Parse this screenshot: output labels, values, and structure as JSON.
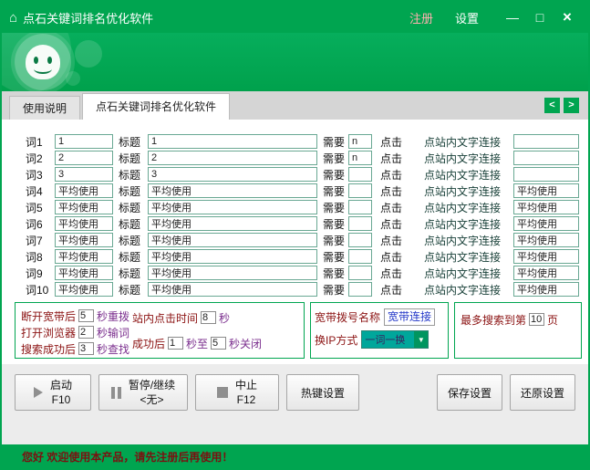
{
  "colors": {
    "brand_green": "#00A550",
    "teal_field": "#00A79B",
    "yellow_field": "#FFFF00",
    "olive_field": "#AEA400",
    "label_maroon": "#8B1212",
    "suffix_purple": "#7B2F8E",
    "link_blue": "#2438C8",
    "muted_text": "#A6A6A6",
    "status_text": "#7A1010"
  },
  "icons": {
    "app": "⌂",
    "min": "—",
    "max": "□",
    "close": "×",
    "prev": "<",
    "next": ">",
    "dropdown": "▼",
    "play": "css-triangle",
    "pause": "css-bars",
    "stop": "css-square"
  },
  "titlebar": {
    "title": "点石关键词排名优化软件",
    "register": "注册",
    "settings": "设置"
  },
  "tabs": {
    "tab1": "使用说明",
    "tab2": "点石关键词排名优化软件"
  },
  "table": {
    "labels": {
      "title": "标题",
      "need": "需要",
      "click": "点击",
      "link": "点站内文字连接"
    },
    "rows": [
      {
        "label": "词1",
        "kw": "1",
        "title": "1",
        "need": "n",
        "link": "",
        "scheme": "teal",
        "link_scheme": "plain"
      },
      {
        "label": "词2",
        "kw": "2",
        "title": "2",
        "need": "n",
        "link": "",
        "scheme": "yellow",
        "link_scheme": "plain"
      },
      {
        "label": "词3",
        "kw": "3",
        "title": "3",
        "need": "",
        "link": "",
        "scheme": "olive",
        "link_scheme": "teal"
      },
      {
        "label": "词4",
        "kw": "平均使用",
        "title": "平均使用",
        "need": "",
        "link": "平均使用",
        "scheme": "muted",
        "link_scheme": "muted"
      },
      {
        "label": "词5",
        "kw": "平均使用",
        "title": "平均使用",
        "need": "",
        "link": "平均使用",
        "scheme": "muted",
        "link_scheme": "muted"
      },
      {
        "label": "词6",
        "kw": "平均使用",
        "title": "平均使用",
        "need": "",
        "link": "平均使用",
        "scheme": "muted",
        "link_scheme": "muted"
      },
      {
        "label": "词7",
        "kw": "平均使用",
        "title": "平均使用",
        "need": "",
        "link": "平均使用",
        "scheme": "muted",
        "link_scheme": "muted"
      },
      {
        "label": "词8",
        "kw": "平均使用",
        "title": "平均使用",
        "need": "",
        "link": "平均使用",
        "scheme": "muted",
        "link_scheme": "muted"
      },
      {
        "label": "词9",
        "kw": "平均使用",
        "title": "平均使用",
        "need": "",
        "link": "平均使用",
        "scheme": "muted",
        "link_scheme": "muted"
      },
      {
        "label": "词10",
        "kw": "平均使用",
        "title": "平均使用",
        "need": "",
        "link": "平均使用",
        "scheme": "muted",
        "link_scheme": "muted"
      }
    ]
  },
  "timing": {
    "rows": [
      {
        "label": "断开宽带后",
        "value": "5",
        "suffix": "秒重拨"
      },
      {
        "label": "打开浏览器",
        "value": "2",
        "suffix": "秒输词"
      },
      {
        "label": "搜索成功后",
        "value": "3",
        "suffix": "秒查找"
      }
    ],
    "site_click": {
      "label": "站内点击时间",
      "value": "8",
      "suffix": "秒"
    },
    "close_after": {
      "label": "成功后",
      "v1": "1",
      "mid": "秒至",
      "v2": "5",
      "suffix": "秒关闭"
    }
  },
  "broadband": {
    "name_label": "宽带拨号名称",
    "name_value": "宽带连接",
    "ip_label": "换IP方式",
    "ip_value": "一词一换"
  },
  "pages": {
    "prefix": "最多搜索到第",
    "value": "10",
    "suffix": "页"
  },
  "actions": {
    "start_label": "启动",
    "start_key": "F10",
    "pause_label": "暂停/继续",
    "pause_key": "<无>",
    "stop_label": "中止",
    "stop_key": "F12",
    "hotkey": "热键设置",
    "save": "保存设置",
    "restore": "还原设置"
  },
  "statusbar": {
    "message": "您好 欢迎使用本产品，请先注册后再使用！"
  }
}
